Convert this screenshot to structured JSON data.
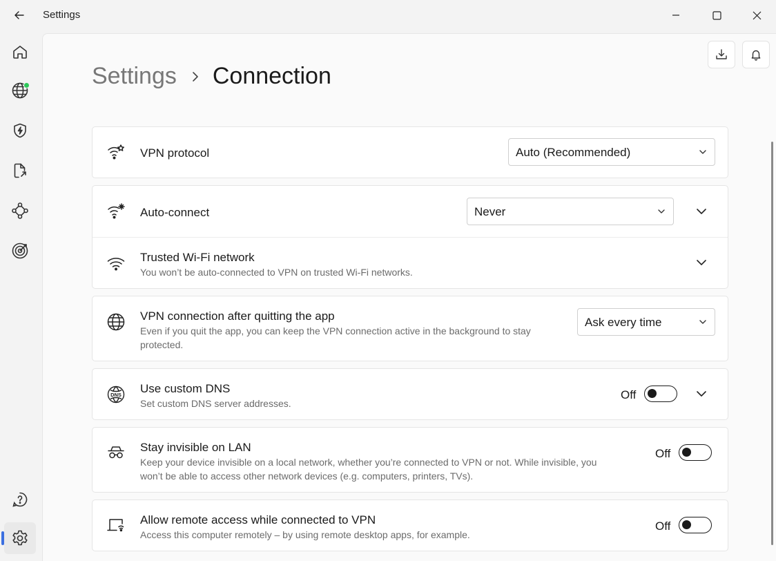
{
  "window": {
    "title": "Settings"
  },
  "nav": {
    "items": [
      {
        "icon": "home-icon"
      },
      {
        "icon": "globe-vpn-icon",
        "status_color": "#2ec85a"
      },
      {
        "icon": "shield-bolt-icon"
      },
      {
        "icon": "file-share-icon"
      },
      {
        "icon": "meshnet-icon"
      },
      {
        "icon": "target-icon"
      },
      {
        "icon": "help-icon"
      },
      {
        "icon": "gear-icon",
        "active": true
      }
    ],
    "accent_color": "#3b6fe0"
  },
  "breadcrumb": {
    "parent": "Settings",
    "current": "Connection"
  },
  "settings": {
    "vpn_protocol": {
      "title": "VPN protocol",
      "value": "Auto (Recommended)"
    },
    "auto_connect": {
      "title": "Auto-connect",
      "value": "Never"
    },
    "trusted_wifi": {
      "title": "Trusted Wi-Fi network",
      "subtitle": "You won’t be auto-connected to VPN on trusted Wi-Fi networks."
    },
    "after_quit": {
      "title": "VPN connection after quitting the app",
      "subtitle": "Even if you quit the app, you can keep the VPN connection active in the background to stay protected.",
      "value": "Ask every time"
    },
    "custom_dns": {
      "title": "Use custom DNS",
      "subtitle": "Set custom DNS server addresses.",
      "state": "Off"
    },
    "invisible_lan": {
      "title": "Stay invisible on LAN",
      "subtitle": "Keep your device invisible on a local network, whether you’re connected to VPN or not. While invisible, you won’t be able to access other network devices (e.g. computers, printers, TVs).",
      "state": "Off"
    },
    "remote_access": {
      "title": "Allow remote access while connected to VPN",
      "subtitle": "Access this computer remotely – by using remote desktop apps, for example.",
      "state": "Off"
    }
  }
}
